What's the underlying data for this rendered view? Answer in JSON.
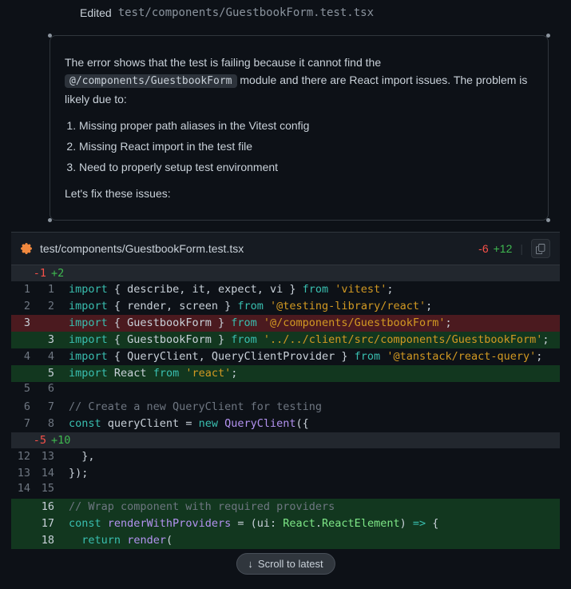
{
  "edited": {
    "label": "Edited",
    "path": "test/components/GuestbookForm.test.tsx"
  },
  "analysis": {
    "intro_pre": "The error shows that the test is failing because it cannot find the ",
    "intro_code": "@/components/GuestbookForm",
    "intro_post": " module and there are React import issues. The problem is likely due to:",
    "items": [
      "Missing proper path aliases in the Vitest config",
      "Missing React import in the test file",
      "Need to properly setup test environment"
    ],
    "outro": "Let's fix these issues:"
  },
  "diff": {
    "file": "test/components/GuestbookForm.test.tsx",
    "deletions": "-6",
    "additions": "+12",
    "hunks": [
      {
        "del": "-1",
        "add": "+2"
      },
      {
        "del": "-5",
        "add": "+10"
      }
    ]
  },
  "chart_data": {
    "type": "table",
    "title": "Unified diff of test/components/GuestbookForm.test.tsx",
    "columns": [
      "old_line",
      "new_line",
      "op",
      "code"
    ],
    "rows": [
      [
        1,
        1,
        "ctx",
        "import { describe, it, expect, vi } from 'vitest';"
      ],
      [
        2,
        2,
        "ctx",
        "import { render, screen } from '@testing-library/react';"
      ],
      [
        3,
        null,
        "del",
        "import { GuestbookForm } from '@/components/GuestbookForm';"
      ],
      [
        null,
        3,
        "add",
        "import { GuestbookForm } from '../../client/src/components/GuestbookForm';"
      ],
      [
        4,
        4,
        "ctx",
        "import { QueryClient, QueryClientProvider } from '@tanstack/react-query';"
      ],
      [
        null,
        5,
        "add",
        "import React from 'react';"
      ],
      [
        5,
        6,
        "ctx",
        ""
      ],
      [
        6,
        7,
        "ctx",
        "// Create a new QueryClient for testing"
      ],
      [
        7,
        8,
        "ctx",
        "const queryClient = new QueryClient({"
      ],
      [
        12,
        13,
        "ctx",
        "  },"
      ],
      [
        13,
        14,
        "ctx",
        "});"
      ],
      [
        14,
        15,
        "ctx",
        ""
      ],
      [
        null,
        16,
        "add",
        "// Wrap component with required providers"
      ],
      [
        null,
        17,
        "add",
        "const renderWithProviders = (ui: React.ReactElement) => {"
      ],
      [
        null,
        18,
        "add",
        "  return render("
      ]
    ]
  },
  "scroll": {
    "label": "Scroll to latest"
  }
}
